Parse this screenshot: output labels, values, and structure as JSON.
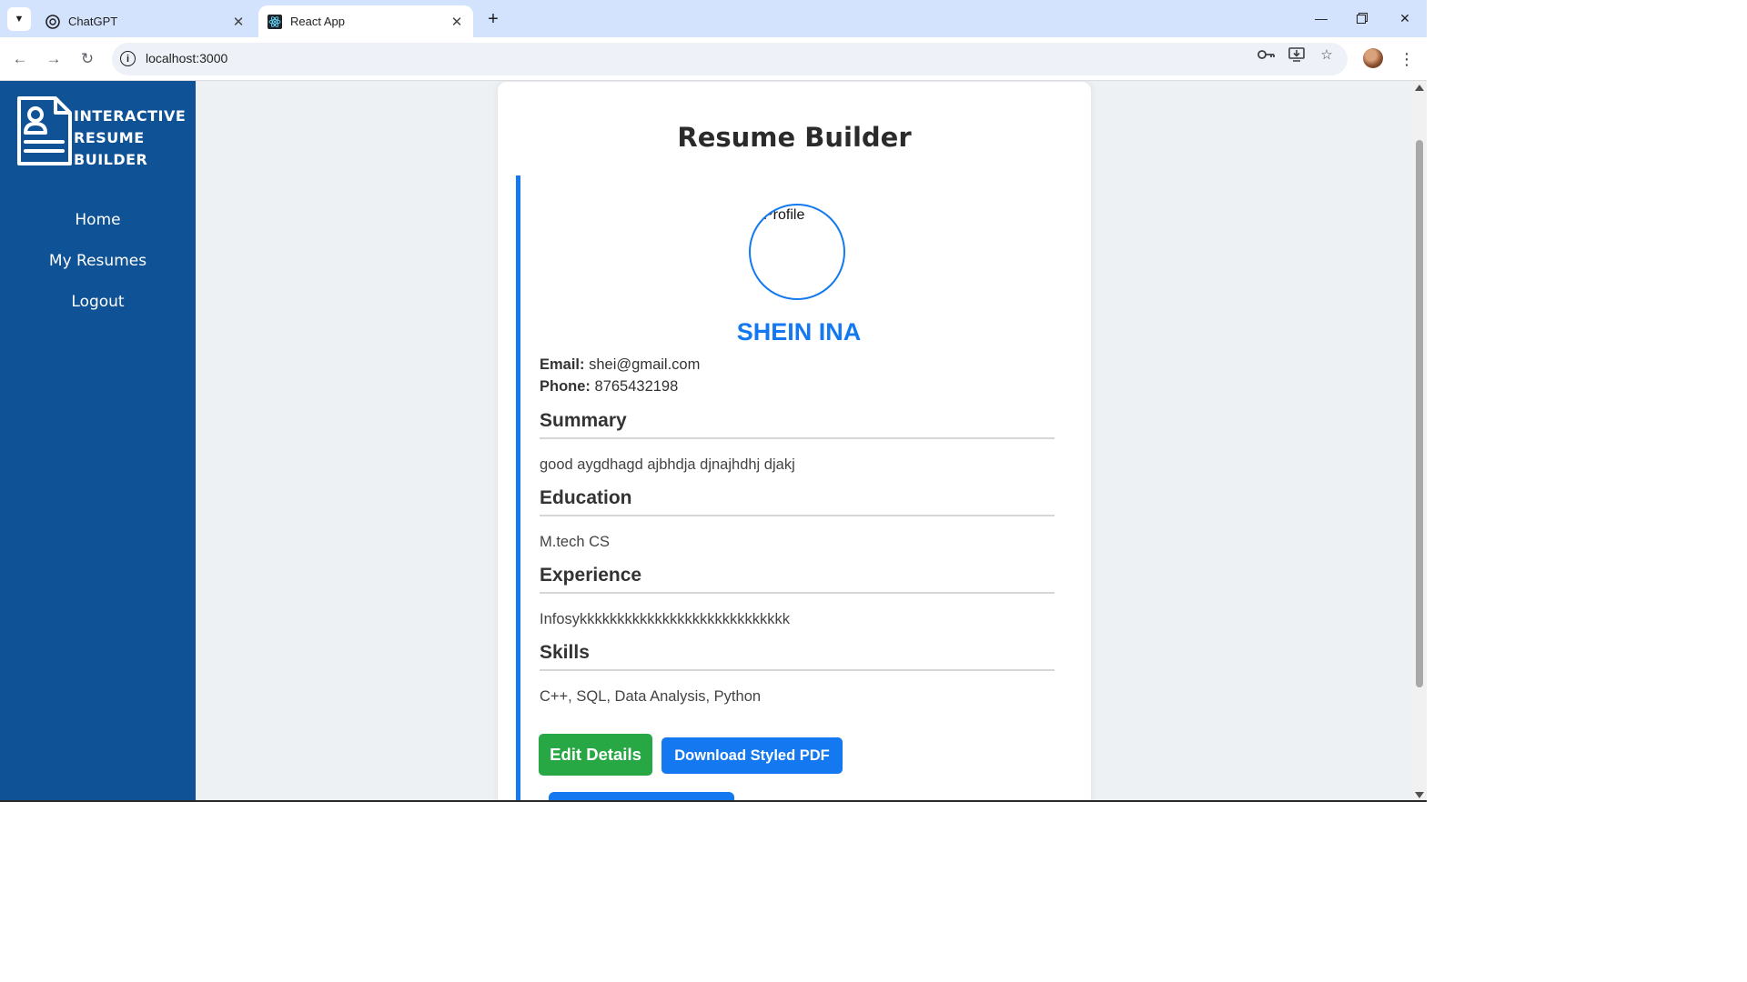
{
  "browser": {
    "tabs": [
      {
        "title": "ChatGPT",
        "icon": "chatgpt-icon",
        "active": false
      },
      {
        "title": "React App",
        "icon": "react-icon",
        "active": true
      }
    ],
    "url": "localhost:3000"
  },
  "sidebar": {
    "logo_lines": [
      "INTERACTIVE",
      "RESUME",
      "BUILDER"
    ],
    "nav": [
      {
        "label": "Home"
      },
      {
        "label": "My Resumes"
      },
      {
        "label": "Logout"
      }
    ]
  },
  "page": {
    "title": "Resume Builder"
  },
  "resume": {
    "photo_alt": "Profile",
    "name": "SHEIN INA",
    "email_label": "Email:",
    "email": "shei@gmail.com",
    "phone_label": "Phone:",
    "phone": "8765432198",
    "sections": [
      {
        "heading": "Summary",
        "content": "good aygdhagd ajbhdja djnajhdhj djakj"
      },
      {
        "heading": "Education",
        "content": "M.tech CS"
      },
      {
        "heading": "Experience",
        "content": "Infosykkkkkkkkkkkkkkkkkkkkkkkkkkkk"
      },
      {
        "heading": "Skills",
        "content": "C++, SQL, Data Analysis, Python"
      }
    ]
  },
  "actions": {
    "edit_label": "Edit Details",
    "pdf_label": "Download Styled PDF"
  },
  "colors": {
    "sidebar": "#0f5295",
    "accent": "#1479f0",
    "edit_button": "#28a745",
    "page_bg": "#eef1f4"
  }
}
